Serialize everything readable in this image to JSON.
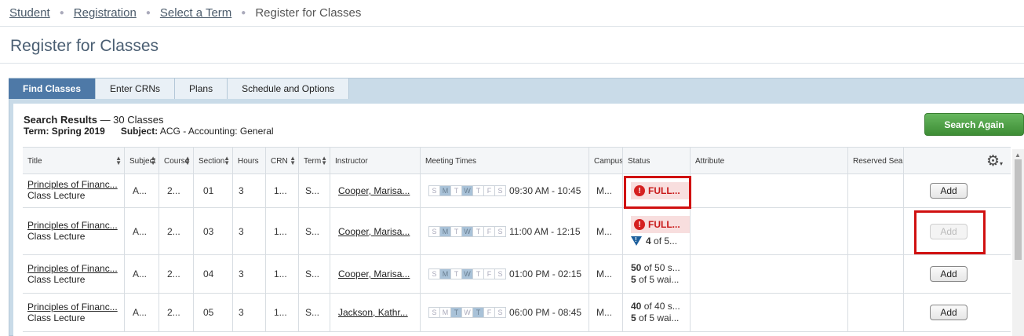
{
  "breadcrumb": {
    "items": [
      {
        "label": "Student",
        "link": true
      },
      {
        "label": "Registration",
        "link": true
      },
      {
        "label": "Select a Term",
        "link": true
      },
      {
        "label": "Register for Classes",
        "link": false
      }
    ]
  },
  "page": {
    "title": "Register for Classes"
  },
  "tabs": [
    {
      "label": "Find Classes",
      "active": true
    },
    {
      "label": "Enter CRNs",
      "active": false
    },
    {
      "label": "Plans",
      "active": false
    },
    {
      "label": "Schedule and Options",
      "active": false
    }
  ],
  "results": {
    "heading": "Search Results",
    "count": "— 30 Classes",
    "term_label": "Term:",
    "term_value": "Spring 2019",
    "subject_label": "Subject:",
    "subject_value": "ACG - Accounting: General",
    "search_again": "Search Again"
  },
  "table": {
    "columns": [
      "Title",
      "Subject",
      "Course",
      "Section",
      "Hours",
      "CRN",
      "Term",
      "Instructor",
      "Meeting Times",
      "Campus",
      "Status",
      "Attribute",
      "Reserved Sea",
      ""
    ],
    "day_letters": [
      "S",
      "M",
      "T",
      "W",
      "T",
      "F",
      "S"
    ],
    "rows": [
      {
        "title": "Principles of Financ...",
        "schedule_type": "Class Lecture",
        "subject": "A...",
        "course": "2...",
        "section": "01",
        "hours": "3",
        "crn": "1...",
        "term": "S...",
        "instructor": "Cooper, Marisa...",
        "days_on": [
          1,
          3
        ],
        "time": "09:30 AM - 10:45",
        "campus": "M...",
        "status_full": "FULL...",
        "status_waitlist": "",
        "seats": "",
        "waitlist": "",
        "add_label": "Add",
        "add_enabled": true
      },
      {
        "title": "Principles of Financ...",
        "schedule_type": "Class Lecture",
        "subject": "A...",
        "course": "2...",
        "section": "03",
        "hours": "3",
        "crn": "1...",
        "term": "S...",
        "instructor": "Cooper, Marisa...",
        "days_on": [
          1,
          3
        ],
        "time": "11:00 AM - 12:15",
        "campus": "M...",
        "status_full": "FULL...",
        "status_waitlist_num": "4",
        "status_waitlist": "of 5...",
        "seats": "",
        "waitlist": "",
        "add_label": "Add",
        "add_enabled": false
      },
      {
        "title": "Principles of Financ...",
        "schedule_type": "Class Lecture",
        "subject": "A...",
        "course": "2...",
        "section": "04",
        "hours": "3",
        "crn": "1...",
        "term": "S...",
        "instructor": "Cooper, Marisa...",
        "days_on": [
          1,
          3
        ],
        "time": "01:00 PM - 02:15",
        "campus": "M...",
        "status_full": "",
        "status_waitlist": "",
        "seats_num": "50",
        "seats": "of 50 s...",
        "waitlist_num": "5",
        "waitlist": "of 5 wai...",
        "add_label": "Add",
        "add_enabled": true
      },
      {
        "title": "Principles of Financ...",
        "schedule_type": "Class Lecture",
        "subject": "A...",
        "course": "2...",
        "section": "05",
        "hours": "3",
        "crn": "1...",
        "term": "S...",
        "instructor": "Jackson, Kathr...",
        "days_on": [
          2,
          4
        ],
        "time": "06:00 PM - 08:45",
        "campus": "M...",
        "status_full": "",
        "status_waitlist": "",
        "seats_num": "40",
        "seats": "of 40 s...",
        "waitlist_num": "5",
        "waitlist": "of 5 wai...",
        "add_label": "Add",
        "add_enabled": true
      }
    ]
  },
  "colors": {
    "accent": "#4e79a7",
    "full": "#c81818",
    "highlight": "#d01010",
    "search_again": "#4a9e42"
  }
}
